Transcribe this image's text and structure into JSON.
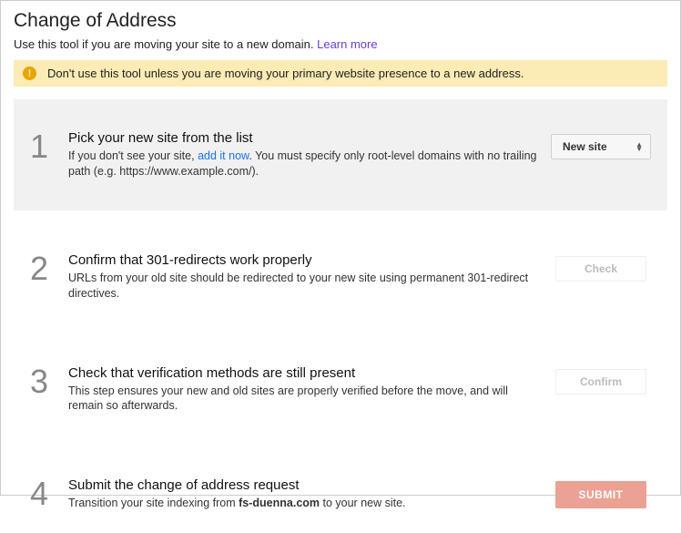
{
  "title": "Change of Address",
  "subtitle_text": "Use this tool if you are moving your site to a new domain. ",
  "subtitle_link": "Learn more",
  "alert_text": "Don't use this tool unless you are moving your primary website presence to a new address.",
  "steps": {
    "s1": {
      "num": "1",
      "title": "Pick your new site from the list",
      "desc_a": "If you don't see your site, ",
      "desc_link": "add it now",
      "desc_b": ". You must specify only root-level domains with no trailing path (e.g. https://www.example.com/).",
      "select_label": "New site"
    },
    "s2": {
      "num": "2",
      "title": "Confirm that 301-redirects work properly",
      "desc": "URLs from your old site should be redirected to your new site using permanent 301-redirect directives.",
      "button": "Check"
    },
    "s3": {
      "num": "3",
      "title": "Check that verification methods are still present",
      "desc": "This step ensures your new and old sites are properly verified before the move, and will remain so afterwards.",
      "button": "Confirm"
    },
    "s4": {
      "num": "4",
      "title": "Submit the change of address request",
      "desc_a": "Transition your site indexing from ",
      "desc_bold": "fs-duenna.com",
      "desc_b": " to your new site.",
      "button": "SUBMIT"
    }
  }
}
